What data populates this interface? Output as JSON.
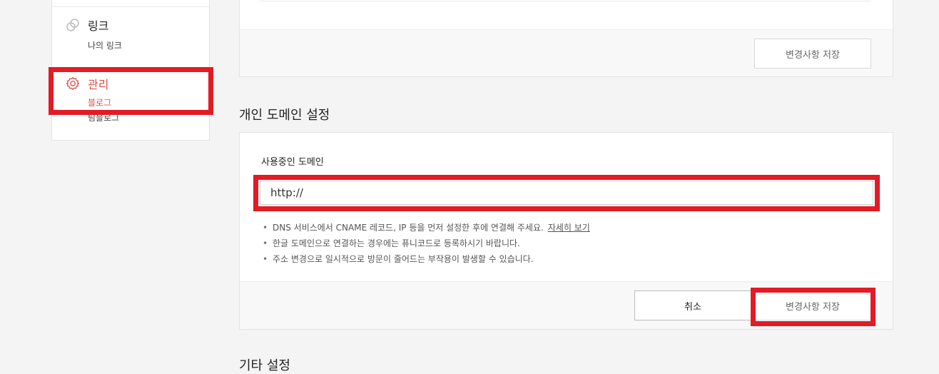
{
  "sidebar": {
    "link": {
      "title": "링크",
      "icon": "link-icon",
      "items": [
        "나의 링크"
      ]
    },
    "manage": {
      "title": "관리",
      "icon": "gear-icon",
      "items": [
        "블로그",
        "팀블로그"
      ],
      "active_item": "블로그"
    }
  },
  "top_card": {
    "save_label": "변경사항 저장"
  },
  "domain_section": {
    "title": "개인 도메인 설정",
    "field_label": "사용중인 도메인",
    "input_value": "http://",
    "notes": [
      "DNS 서비스에서 CNAME 레코드, IP 등을 먼저 설정한 후에 연결해 주세요.",
      "한글 도메인으로 연결하는 경우에는 퓨니코드로 등록하시기 바랍니다.",
      "주소 변경으로 일시적으로 방문이 줄어드는 부작용이 발생할 수 있습니다."
    ],
    "more_link": "자세히 보기",
    "cancel_label": "취소",
    "save_label": "변경사항 저장"
  },
  "next_section": {
    "title": "기타 설정"
  },
  "colors": {
    "accent": "#e14d4a",
    "annotation": "#e21b24"
  }
}
